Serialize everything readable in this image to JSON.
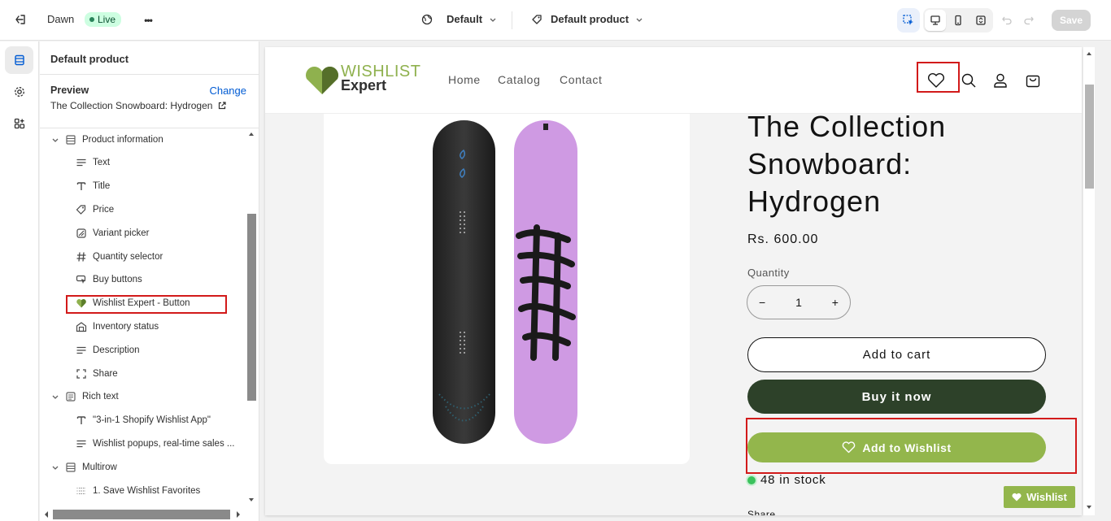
{
  "topbar": {
    "theme_name": "Dawn",
    "live_label": "Live",
    "more_label": "•••",
    "theme_select": "Default",
    "template_select": "Default product",
    "save_label": "Save"
  },
  "sidebar": {
    "title": "Default product",
    "preview_label": "Preview",
    "change_label": "Change",
    "preview_value": "The Collection Snowboard: Hydrogen",
    "sections": [
      {
        "label": "Product information",
        "icon": "section-icon"
      },
      {
        "label": "Rich text",
        "icon": "richtext-icon"
      },
      {
        "label": "Multirow",
        "icon": "section-icon"
      }
    ],
    "blocks": [
      {
        "label": "Text",
        "icon": "text-lines-icon"
      },
      {
        "label": "Title",
        "icon": "title-t-icon"
      },
      {
        "label": "Price",
        "icon": "price-tag-icon"
      },
      {
        "label": "Variant picker",
        "icon": "variant-icon"
      },
      {
        "label": "Quantity selector",
        "icon": "hash-icon"
      },
      {
        "label": "Buy buttons",
        "icon": "buy-cursor-icon"
      },
      {
        "label": "Wishlist Expert - Button",
        "icon": "wishlist-heart-icon"
      },
      {
        "label": "Inventory status",
        "icon": "inventory-icon"
      },
      {
        "label": "Description",
        "icon": "text-lines-icon"
      },
      {
        "label": "Share",
        "icon": "share-icon"
      },
      {
        "label": "\"3-in-1 Shopify Wishlist App\"",
        "icon": "title-t-icon"
      },
      {
        "label": "Wishlist popups, real-time sales ...",
        "icon": "text-lines-icon"
      },
      {
        "label": "1. Save Wishlist Favorites",
        "icon": "row-icon"
      }
    ]
  },
  "store": {
    "logo_top": "WISHLIST",
    "logo_bottom": "Expert",
    "nav": [
      "Home",
      "Catalog",
      "Contact"
    ],
    "product_title": "The Collection Snowboard: Hydrogen",
    "price": "Rs. 600.00",
    "quantity_label": "Quantity",
    "quantity_value": "1",
    "qty_minus": "−",
    "qty_plus": "+",
    "add_to_cart": "Add to cart",
    "buy_now": "Buy it now",
    "add_to_wishlist": "Add to Wishlist",
    "stock": "48 in stock",
    "share": "Share",
    "floating_wishlist": "Wishlist"
  },
  "colors": {
    "brand_green": "#93b64c",
    "buy_button": "#2d4129",
    "highlight_red": "#d21a1a",
    "link_blue": "#005bd3"
  }
}
